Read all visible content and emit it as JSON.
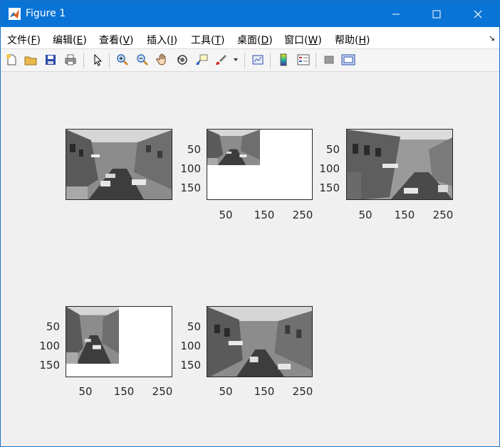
{
  "window": {
    "title": "Figure 1"
  },
  "menu": {
    "items": [
      {
        "label": "文件(",
        "key": "F",
        "end": ")"
      },
      {
        "label": "编辑(",
        "key": "E",
        "end": ")"
      },
      {
        "label": "查看(",
        "key": "V",
        "end": ")"
      },
      {
        "label": "插入(",
        "key": "I",
        "end": ")"
      },
      {
        "label": "工具(",
        "key": "T",
        "end": ")"
      },
      {
        "label": "桌面(",
        "key": "D",
        "end": ")"
      },
      {
        "label": "窗口(",
        "key": "W",
        "end": ")"
      },
      {
        "label": "帮助(",
        "key": "H",
        "end": ")"
      }
    ],
    "dock_icon": "↘"
  },
  "toolbar": {
    "icons": [
      "new-figure-icon",
      "open-file-icon",
      "save-icon",
      "print-icon",
      "select-arrow-icon",
      "zoom-in-icon",
      "zoom-out-icon",
      "pan-hand-icon",
      "rotate-3d-icon",
      "data-cursor-icon",
      "brush-icon",
      "link-plot-icon",
      "colorbar-icon",
      "legend-icon",
      "hide-plot-tools-icon",
      "show-plot-tools-icon"
    ]
  },
  "axes": [
    {
      "id": "ax1",
      "xticks": [],
      "yticks": []
    },
    {
      "id": "ax2",
      "xticks": [
        "50",
        "150",
        "250"
      ],
      "yticks": [
        "50",
        "100",
        "150"
      ]
    },
    {
      "id": "ax3",
      "xticks": [
        "50",
        "150",
        "250"
      ],
      "yticks": [
        "50",
        "100",
        "150"
      ]
    },
    {
      "id": "ax4",
      "xticks": [
        "50",
        "150",
        "250"
      ],
      "yticks": [
        "50",
        "100",
        "150"
      ]
    },
    {
      "id": "ax5",
      "xticks": [
        "50",
        "150",
        "250"
      ],
      "yticks": [
        "50",
        "100",
        "150"
      ]
    }
  ],
  "colors": {
    "titlebar": "#0a74d6",
    "figure_bg": "#f0f0f0",
    "axis": "#262626"
  }
}
